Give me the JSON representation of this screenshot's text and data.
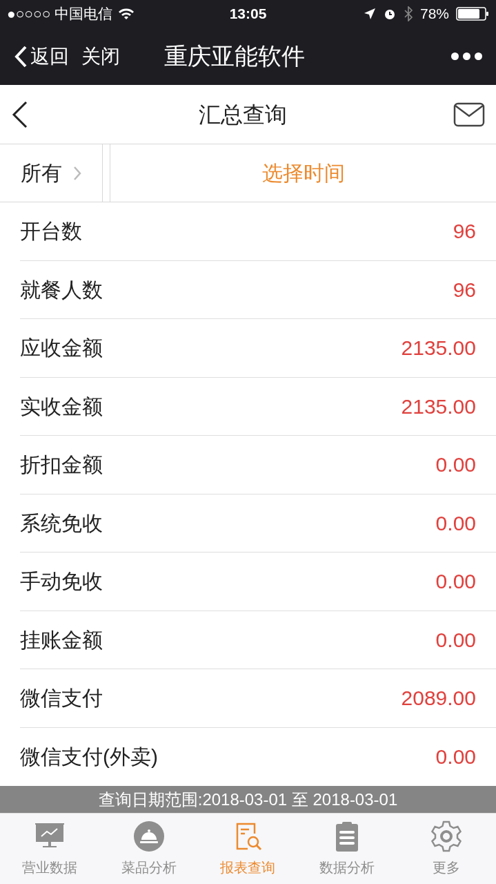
{
  "status_bar": {
    "carrier": "●○○○○ 中国电信",
    "time": "13:05",
    "battery": "78%"
  },
  "nav_bar": {
    "back": "返回",
    "close": "关闭",
    "title": "重庆亚能软件"
  },
  "header": {
    "title": "汇总查询"
  },
  "filter": {
    "scope": "所有",
    "time": "选择时间"
  },
  "rows": [
    {
      "label": "开台数",
      "value": "96"
    },
    {
      "label": "就餐人数",
      "value": "96"
    },
    {
      "label": "应收金额",
      "value": "2135.00"
    },
    {
      "label": "实收金额",
      "value": "2135.00"
    },
    {
      "label": "折扣金额",
      "value": "0.00"
    },
    {
      "label": "系统免收",
      "value": "0.00"
    },
    {
      "label": "手动免收",
      "value": "0.00"
    },
    {
      "label": "挂账金额",
      "value": "0.00"
    },
    {
      "label": "微信支付",
      "value": "2089.00"
    },
    {
      "label": "微信支付(外卖)",
      "value": "0.00"
    }
  ],
  "date_range": "查询日期范围:2018-03-01 至 2018-03-01",
  "tabs": [
    {
      "label": "营业数据",
      "kind": "monitor",
      "selected": false
    },
    {
      "label": "菜品分析",
      "kind": "cloche",
      "selected": false
    },
    {
      "label": "报表查询",
      "kind": "report",
      "selected": true
    },
    {
      "label": "数据分析",
      "kind": "clipboard",
      "selected": false
    },
    {
      "label": "更多",
      "kind": "gear",
      "selected": false
    }
  ]
}
